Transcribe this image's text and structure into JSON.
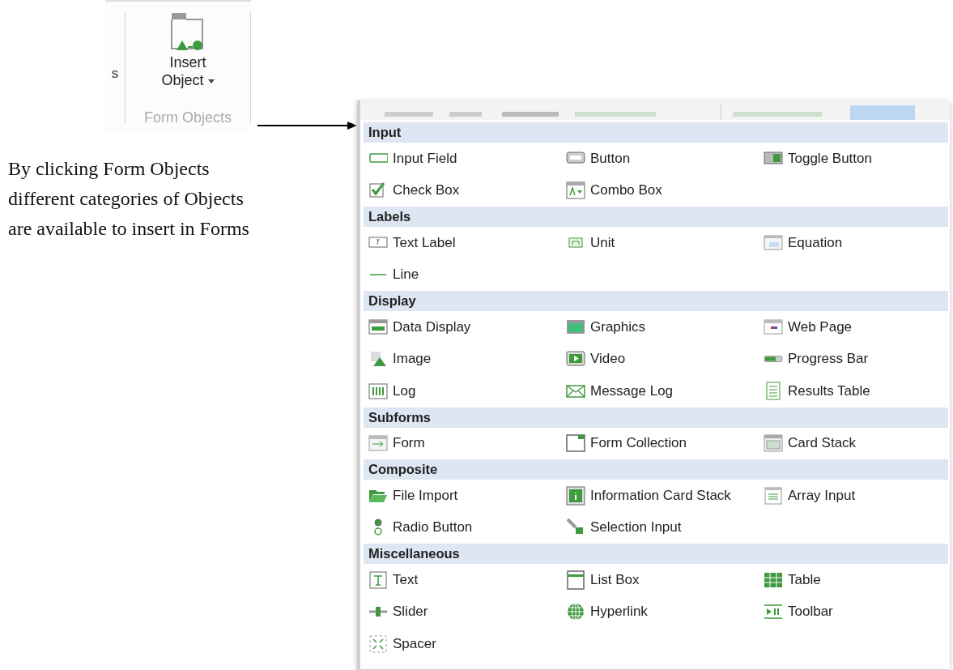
{
  "ribbon": {
    "cut_label": "s",
    "button": {
      "lines": [
        "Insert",
        "Object"
      ],
      "has_caret": true
    },
    "group_label": "Form Objects"
  },
  "caption": {
    "lines": [
      "By clicking Form Objects",
      "different categories of Objects",
      "are available to insert in Forms"
    ]
  },
  "menu": {
    "sections": [
      {
        "title": "Input",
        "items": [
          "Input Field",
          "Button",
          "Toggle Button",
          "Check Box",
          "Combo Box"
        ]
      },
      {
        "title": "Labels",
        "items": [
          "Text Label",
          "Unit",
          "Equation",
          "Line"
        ]
      },
      {
        "title": "Display",
        "items": [
          "Data Display",
          "Graphics",
          "Web Page",
          "Image",
          "Video",
          "Progress Bar",
          "Log",
          "Message Log",
          "Results Table"
        ]
      },
      {
        "title": "Subforms",
        "items": [
          "Form",
          "Form Collection",
          "Card Stack"
        ]
      },
      {
        "title": "Composite",
        "items": [
          "File Import",
          "Information Card Stack",
          "Array Input",
          "Radio Button",
          "Selection Input"
        ]
      },
      {
        "title": "Miscellaneous",
        "items": [
          "Text",
          "List Box",
          "Table",
          "Slider",
          "Hyperlink",
          "Toolbar",
          "Spacer"
        ]
      }
    ]
  }
}
